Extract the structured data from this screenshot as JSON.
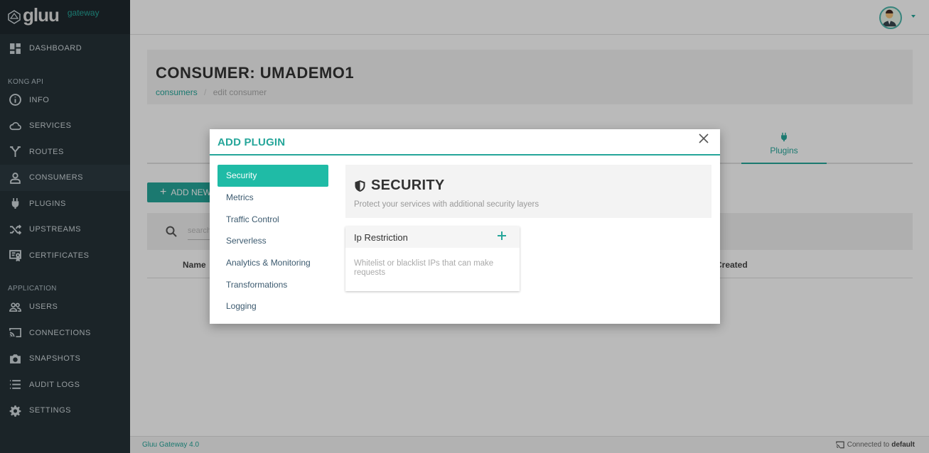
{
  "brand": {
    "name": "gluu",
    "subtitle": "gateway"
  },
  "sidebar": {
    "top_items": [
      {
        "label": "DASHBOARD",
        "icon": "dashboard-icon"
      }
    ],
    "sections": [
      {
        "title": "KONG API",
        "items": [
          {
            "label": "INFO",
            "icon": "info-icon"
          },
          {
            "label": "SERVICES",
            "icon": "cloud-icon"
          },
          {
            "label": "ROUTES",
            "icon": "routes-icon"
          },
          {
            "label": "CONSUMERS",
            "icon": "user-icon",
            "active": true
          },
          {
            "label": "PLUGINS",
            "icon": "plug-icon"
          },
          {
            "label": "UPSTREAMS",
            "icon": "shuffle-icon"
          },
          {
            "label": "CERTIFICATES",
            "icon": "certificate-icon"
          }
        ]
      },
      {
        "title": "APPLICATION",
        "items": [
          {
            "label": "USERS",
            "icon": "users-icon"
          },
          {
            "label": "CONNECTIONS",
            "icon": "cast-icon"
          },
          {
            "label": "SNAPSHOTS",
            "icon": "camera-icon"
          },
          {
            "label": "AUDIT LOGS",
            "icon": "list-icon"
          },
          {
            "label": "SETTINGS",
            "icon": "gear-icon"
          }
        ]
      }
    ]
  },
  "page": {
    "title": "CONSUMER: UMADEMO1",
    "breadcrumb": {
      "link": "consumers",
      "separator": "/",
      "current": "edit consumer"
    },
    "tab_plugins": "Plugins",
    "add_button": "ADD NEW",
    "search_placeholder": "search",
    "table_headers": {
      "name": "Name",
      "created": "Created"
    }
  },
  "footer": {
    "version": "Gluu Gateway 4.0",
    "connected_label": "Connected to",
    "connection": "default"
  },
  "modal": {
    "title": "ADD PLUGIN",
    "categories": [
      {
        "label": "Security",
        "active": true
      },
      {
        "label": "Metrics"
      },
      {
        "label": "Traffic Control"
      },
      {
        "label": "Serverless"
      },
      {
        "label": "Analytics & Monitoring"
      },
      {
        "label": "Transformations"
      },
      {
        "label": "Logging"
      }
    ],
    "section": {
      "title": "SECURITY",
      "description": "Protect your services with additional security layers"
    },
    "plugins": [
      {
        "name": "Ip Restriction",
        "description": "Whitelist or blacklist IPs that can make requests"
      }
    ]
  },
  "colors": {
    "accent": "#26a69a",
    "sidebar": "#263238",
    "category_active": "#1fbba6"
  }
}
